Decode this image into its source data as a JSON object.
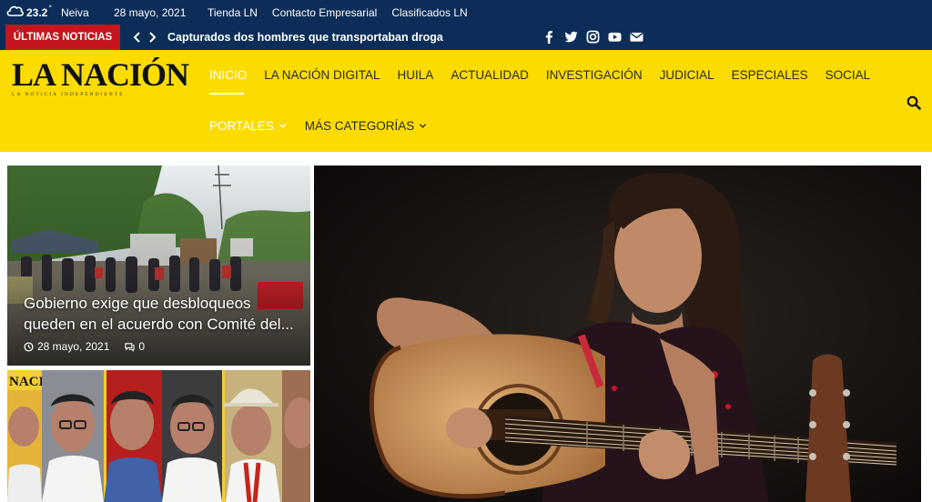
{
  "topbar": {
    "temperature": "23.2",
    "degree": "°",
    "city": "Neiva",
    "date": "28 mayo, 2021",
    "links": [
      "Tienda LN",
      "Contacto Empresarial",
      "Clasificados LN"
    ],
    "weather_icon": "cloud-icon"
  },
  "breaking": {
    "label": "ÚLTIMAS NOTICIAS",
    "headline": "Capturados dos hombres que transportaban droga",
    "label_color": "#c4161c",
    "social_icons": [
      "facebook-icon",
      "twitter-icon",
      "instagram-icon",
      "youtube-icon",
      "envelope-icon"
    ]
  },
  "header": {
    "logo_text": "LA NACIÓN",
    "logo_sub": "LA NOTICIA INDEPENDIENTE",
    "nav_main": [
      "INICIO",
      "LA NACIÓN DIGITAL",
      "HUILA",
      "ACTUALIDAD",
      "INVESTIGACIÓN",
      "JUDICIAL",
      "ESPECIALES",
      "SOCIAL"
    ],
    "nav_secondary": [
      "PORTALES",
      "MÁS CATEGORÍAS"
    ],
    "background_color": "#fcdc00",
    "bar_color": "#0b2d57"
  },
  "articles": {
    "main": {
      "title": " Gobierno exige que desbloqueos queden en el acuerdo con Comité del...",
      "date": "28 mayo, 2021",
      "comments": "0"
    },
    "secondary_logo_text": "NACIÓN"
  }
}
